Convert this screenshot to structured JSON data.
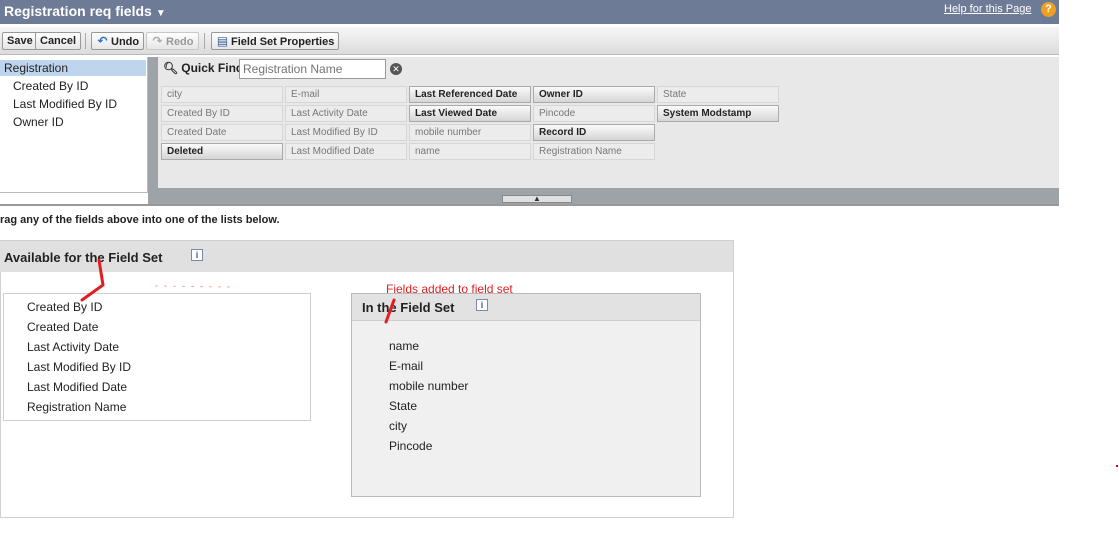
{
  "header": {
    "title": "Registration req fields",
    "help_link": "Help for this Page",
    "help_icon": "?"
  },
  "toolbar": {
    "save": "Save",
    "cancel": "Cancel",
    "undo": "Undo",
    "redo": "Redo",
    "field_set_properties": "Field Set Properties"
  },
  "objects": {
    "selected": "Registration",
    "children": [
      "Created By ID",
      "Last Modified By ID",
      "Owner ID"
    ]
  },
  "quick_find": {
    "label": "Quick Find",
    "placeholder": "Registration Name"
  },
  "fields": [
    [
      "city",
      "Created By ID",
      "Created Date",
      "Deleted"
    ],
    [
      "E-mail",
      "Last Activity Date",
      "Last Modified By ID",
      "Last Modified Date"
    ],
    [
      "Last Referenced Date",
      "Last Viewed Date",
      "mobile number",
      "name"
    ],
    [
      "Owner ID",
      "Pincode",
      "Record ID",
      "Registration Name"
    ],
    [
      "State",
      "System Modstamp"
    ]
  ],
  "instructions": "rag any of the fields above into one of the lists below.",
  "available": {
    "title": "Available for the Field Set",
    "items": [
      "Created By ID",
      "Created Date",
      "Last Activity Date",
      "Last Modified By ID",
      "Last Modified Date",
      "Registration Name"
    ]
  },
  "in_field_set": {
    "title": "In the Field Set",
    "items": [
      "name",
      "E-mail",
      "mobile number",
      "State",
      "city",
      "Pincode"
    ]
  },
  "annotation": {
    "text": "Fields added to field set",
    "color": "#e02020"
  }
}
